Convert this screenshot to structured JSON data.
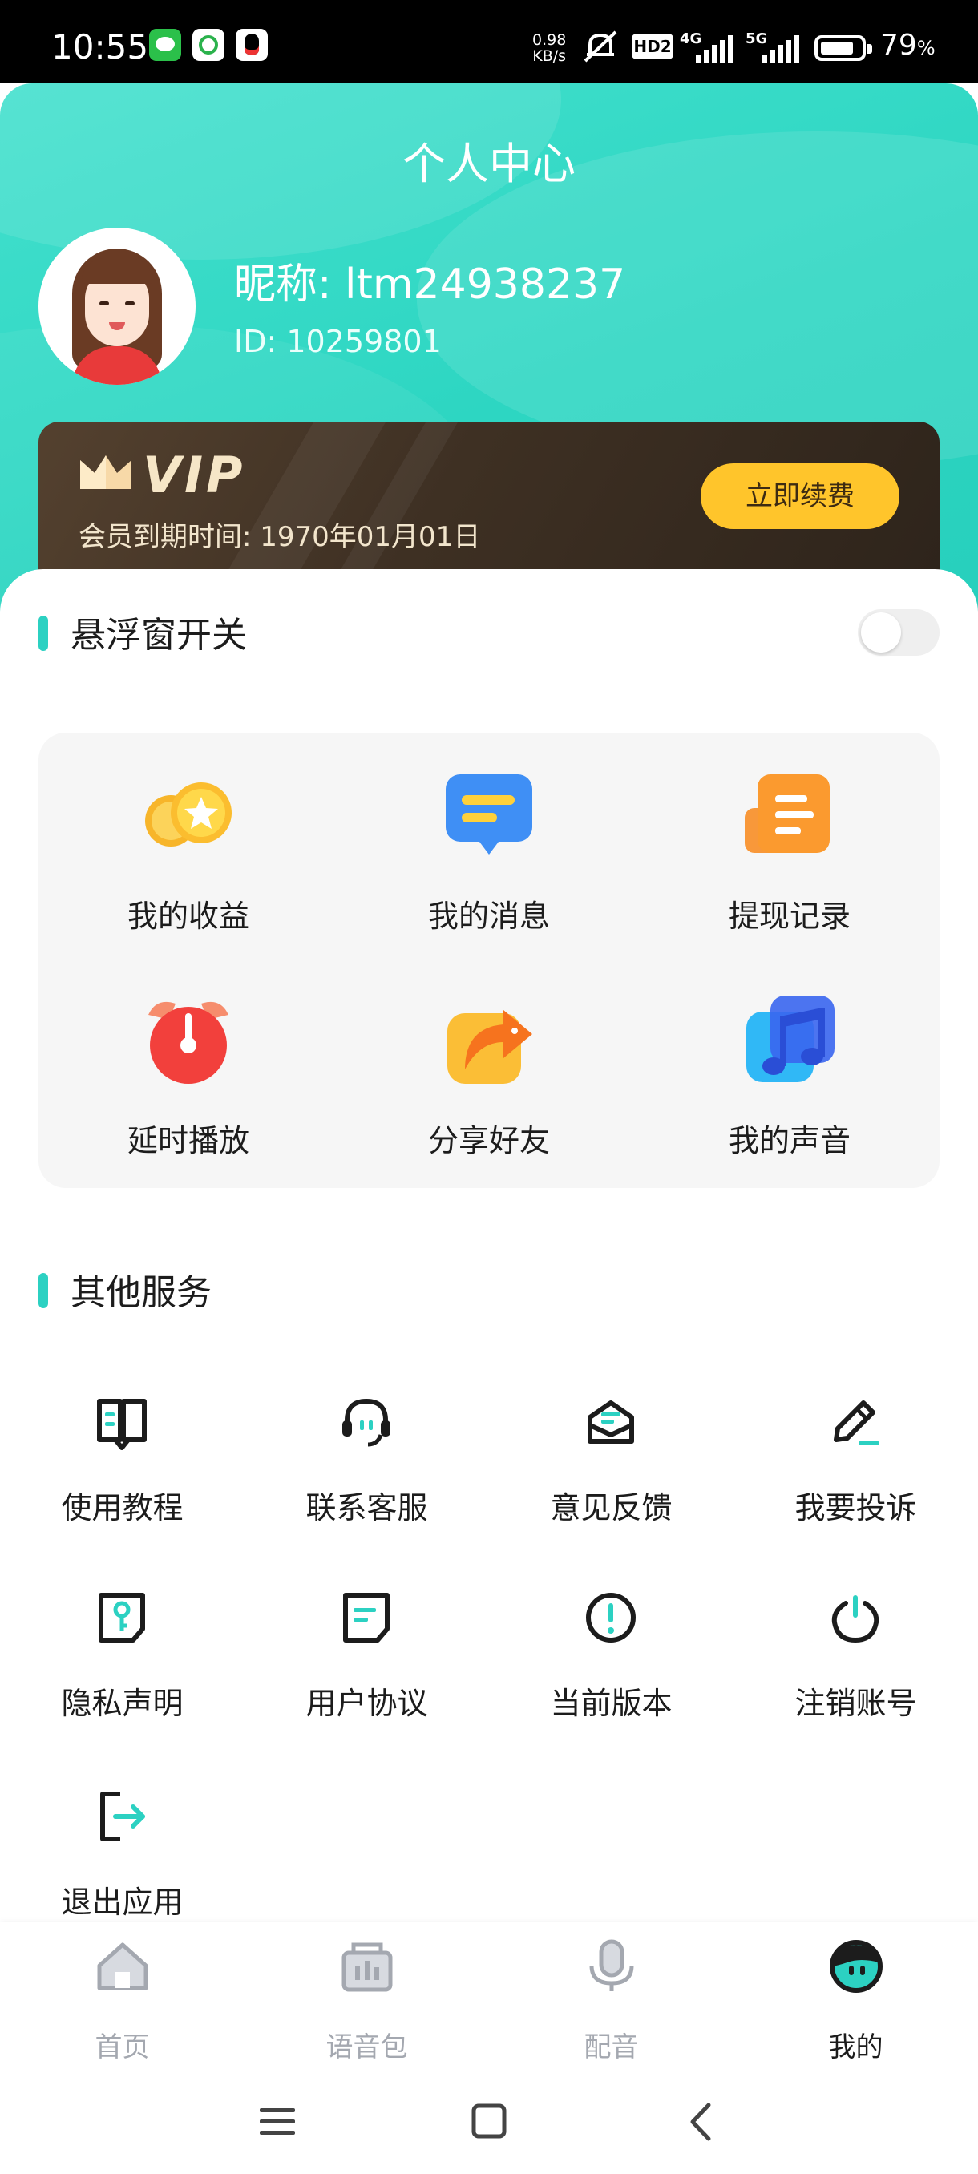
{
  "status_bar": {
    "time": "10:55",
    "net_speed_value": "0.98",
    "net_speed_unit": "KB/s",
    "hd_badge": "HD2",
    "signal1_label": "4G",
    "signal2_label": "5G",
    "battery_percent": "79",
    "battery_unit": "%",
    "notification_icons": [
      "wechat-icon",
      "swirl-app-icon",
      "qq-icon"
    ]
  },
  "header": {
    "title": "个人中心",
    "nickname": "昵称: ltm24938237",
    "user_id": "ID: 10259801"
  },
  "vip": {
    "badge": "VIP",
    "expire_text": "会员到期时间: 1970年01月01日",
    "renew_button": "立即续费"
  },
  "floating_window": {
    "label": "悬浮窗开关",
    "enabled": false
  },
  "features": [
    {
      "label": "我的收益",
      "icon": "coins-icon"
    },
    {
      "label": "我的消息",
      "icon": "message-icon"
    },
    {
      "label": "提现记录",
      "icon": "document-icon"
    },
    {
      "label": "延时播放",
      "icon": "alarm-clock-icon"
    },
    {
      "label": "分享好友",
      "icon": "share-icon"
    },
    {
      "label": "我的声音",
      "icon": "music-note-icon"
    }
  ],
  "other_services": {
    "title": "其他服务",
    "items": [
      {
        "label": "使用教程",
        "icon": "book-icon"
      },
      {
        "label": "联系客服",
        "icon": "headset-icon"
      },
      {
        "label": "意见反馈",
        "icon": "mail-icon"
      },
      {
        "label": "我要投诉",
        "icon": "pen-icon"
      },
      {
        "label": "隐私声明",
        "icon": "key-icon"
      },
      {
        "label": "用户协议",
        "icon": "agreement-icon"
      },
      {
        "label": "当前版本",
        "icon": "info-icon"
      },
      {
        "label": "注销账号",
        "icon": "power-icon"
      },
      {
        "label": "退出应用",
        "icon": "logout-icon"
      }
    ]
  },
  "bottom_nav": [
    {
      "label": "首页",
      "icon": "home-icon",
      "active": false
    },
    {
      "label": "语音包",
      "icon": "voice-pack-icon",
      "active": false
    },
    {
      "label": "配音",
      "icon": "microphone-icon",
      "active": false
    },
    {
      "label": "我的",
      "icon": "profile-face-icon",
      "active": true
    }
  ],
  "colors": {
    "accent": "#2cd1c2",
    "vip_button": "#ffc52b",
    "vip_card": "#3e3023",
    "inactive_nav": "#a4a8b0"
  }
}
